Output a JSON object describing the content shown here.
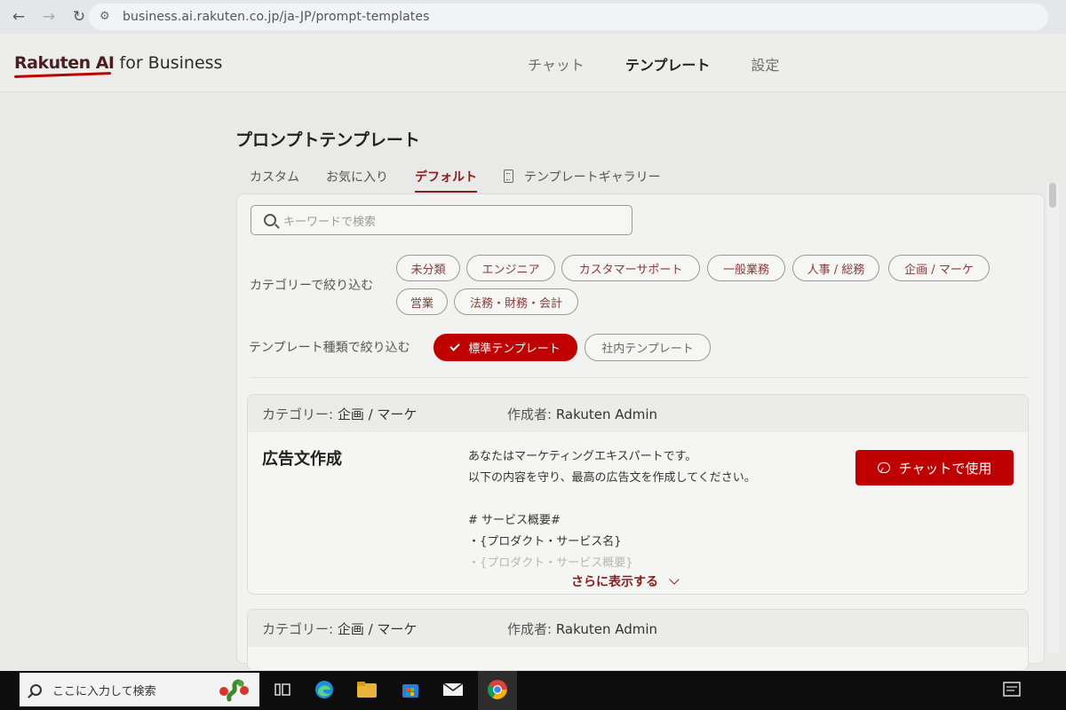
{
  "browser": {
    "url": "business.ai.rakuten.co.jp/ja-JP/prompt-templates"
  },
  "header": {
    "logo_brand": "Rakuten AI",
    "logo_suffix": "for Business",
    "nav": [
      "チャット",
      "テンプレート",
      "設定"
    ],
    "active_nav": "テンプレート"
  },
  "main": {
    "title": "プロンプトテンプレート",
    "tabs": [
      "カスタム",
      "お気に入り",
      "デフォルト",
      "テンプレートギャラリー"
    ],
    "active_tab": "デフォルト",
    "search_placeholder": "キーワードで検索",
    "category_filter_label": "カテゴリーで絞り込む",
    "categories": [
      "未分類",
      "エンジニア",
      "カスタマーサポート",
      "一般業務",
      "人事 / 総務",
      "企画 / マーケ",
      "営業",
      "法務・財務・会計"
    ],
    "type_filter_label": "テンプレート種類で絞り込む",
    "types": [
      "標準テンプレート",
      "社内テンプレート"
    ],
    "selected_type": "標準テンプレート"
  },
  "cards": [
    {
      "category_label": "カテゴリー:",
      "category": "企画 / マーケ",
      "author_label": "作成者:",
      "author": "Rakuten Admin",
      "title": "広告文作成",
      "body_lines": [
        "あなたはマーケティングエキスパートです。",
        "以下の内容を守り、最高の広告文を作成してください。",
        "",
        "# サービス概要#",
        "・{プロダクト・サービス名}",
        "・{プロダクト・サービス概要}"
      ],
      "use_button": "チャットで使用",
      "show_more": "さらに表示する"
    },
    {
      "category_label": "カテゴリー:",
      "category": "企画 / マーケ",
      "author_label": "作成者:",
      "author": "Rakuten Admin"
    }
  ],
  "taskbar": {
    "search_placeholder": "ここに入力して検索"
  },
  "colors": {
    "accent": "#bf0000",
    "accent_dark": "#8b1d1d",
    "page_bg": "#e9e9e7"
  }
}
